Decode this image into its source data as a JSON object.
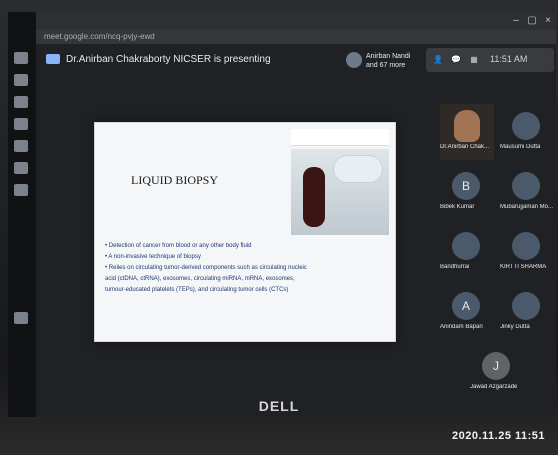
{
  "browser": {
    "url": "meet.google.com/ncq-pvjy-ewd",
    "window_controls": [
      "–",
      "▢",
      "×"
    ]
  },
  "meet": {
    "presenter_text": "Dr.Anirban Chakraborty NICSER is presenting",
    "participants_chip": "Anirban Nandi and 67 more",
    "clock": "11:51 AM"
  },
  "slide": {
    "title": "LIQUID BIOPSY",
    "bullets": [
      "• Detection of cancer from blood or any other body fluid",
      "• A non-invasive technique of biopsy",
      "• Relies on circulating tumor-derived components such as circulating nucleic",
      "  acid (ctDNA, ctRNA), exosomes, circulating miRNA, mRNA, exosomes,",
      "  tumour-educated platelets (TEPs), and circulating tumor cells (CTCs)"
    ]
  },
  "participants": [
    {
      "name": "Dr.Anirban Chak...",
      "initial": ""
    },
    {
      "name": "Mausumi Dutta",
      "initial": ""
    },
    {
      "name": "Bibek Kumar",
      "initial": "B"
    },
    {
      "name": "Mubarujjaman Mo...",
      "initial": ""
    },
    {
      "name": "Bandhurrai",
      "initial": ""
    },
    {
      "name": "KIRTTI SHARMA",
      "initial": ""
    },
    {
      "name": "Anindam Bapari",
      "initial": "A"
    },
    {
      "name": "Jinky Dutta",
      "initial": ""
    },
    {
      "name": "Jawad Azgarzade",
      "initial": "J"
    }
  ],
  "monitor_brand": "DELL",
  "camera_timestamp": "2020.11.25 11:51"
}
